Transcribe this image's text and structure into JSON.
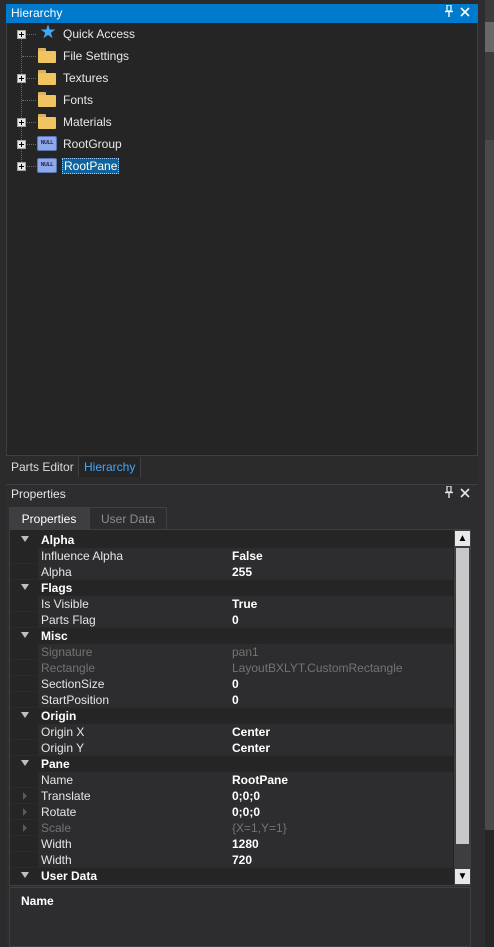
{
  "hierarchy": {
    "title": "Hierarchy",
    "pin_glyph": "📌",
    "close_glyph": "✕",
    "items": [
      {
        "label": "Quick Access",
        "icon": "star-icon",
        "expander": true
      },
      {
        "label": "File Settings",
        "icon": "folder-icon",
        "expander": false
      },
      {
        "label": "Textures",
        "icon": "folder-icon",
        "expander": true
      },
      {
        "label": "Fonts",
        "icon": "folder-icon",
        "expander": false
      },
      {
        "label": "Materials",
        "icon": "folder-icon",
        "expander": true
      },
      {
        "label": "RootGroup",
        "icon": "null-pane-icon",
        "expander": true,
        "icon_text": "NULL"
      },
      {
        "label": "RootPane",
        "icon": "null-pane-icon",
        "expander": true,
        "icon_text": "NULL",
        "selected": true
      }
    ],
    "bottom_tabs": [
      {
        "label": "Parts Editor",
        "active": false
      },
      {
        "label": "Hierarchy",
        "active": true
      }
    ]
  },
  "properties": {
    "title": "Properties",
    "tabs": [
      {
        "label": "Properties",
        "active": true
      },
      {
        "label": "User Data",
        "active": false
      }
    ],
    "rows": [
      {
        "type": "category",
        "name": "Alpha"
      },
      {
        "type": "item",
        "name": "Influence Alpha",
        "value": "False"
      },
      {
        "type": "item",
        "name": "Alpha",
        "value": "255"
      },
      {
        "type": "category",
        "name": "Flags"
      },
      {
        "type": "item",
        "name": "Is Visible",
        "value": "True"
      },
      {
        "type": "item",
        "name": "Parts Flag",
        "value": "0"
      },
      {
        "type": "category",
        "name": "Misc"
      },
      {
        "type": "item",
        "name": "Signature",
        "value": "pan1",
        "disabled": true
      },
      {
        "type": "item",
        "name": "Rectangle",
        "value": "LayoutBXLYT.CustomRectangle",
        "disabled": true
      },
      {
        "type": "item",
        "name": "SectionSize",
        "value": "0"
      },
      {
        "type": "item",
        "name": "StartPosition",
        "value": "0"
      },
      {
        "type": "category",
        "name": "Origin"
      },
      {
        "type": "item",
        "name": "Origin X",
        "value": "Center"
      },
      {
        "type": "item",
        "name": "Origin Y",
        "value": "Center"
      },
      {
        "type": "category",
        "name": "Pane"
      },
      {
        "type": "item",
        "name": "Name",
        "value": "RootPane"
      },
      {
        "type": "item",
        "name": "Translate",
        "value": "0;0;0",
        "subexpander": true
      },
      {
        "type": "item",
        "name": "Rotate",
        "value": "0;0;0",
        "subexpander": true
      },
      {
        "type": "item",
        "name": "Scale",
        "value": "{X=1,Y=1}",
        "disabled": true,
        "subexpander": true
      },
      {
        "type": "item",
        "name": "Width",
        "value": "1280"
      },
      {
        "type": "item",
        "name": "Width",
        "value": "720"
      },
      {
        "type": "category",
        "name": "User Data"
      }
    ],
    "description_title": "Name",
    "scroll_up_glyph": "▲",
    "scroll_down_glyph": "▼"
  },
  "colors": {
    "accent": "#007acc",
    "selection": "#0e639c",
    "panel_bg": "#252526",
    "chrome_bg": "#2d2d30",
    "folder": "#f0c460"
  }
}
